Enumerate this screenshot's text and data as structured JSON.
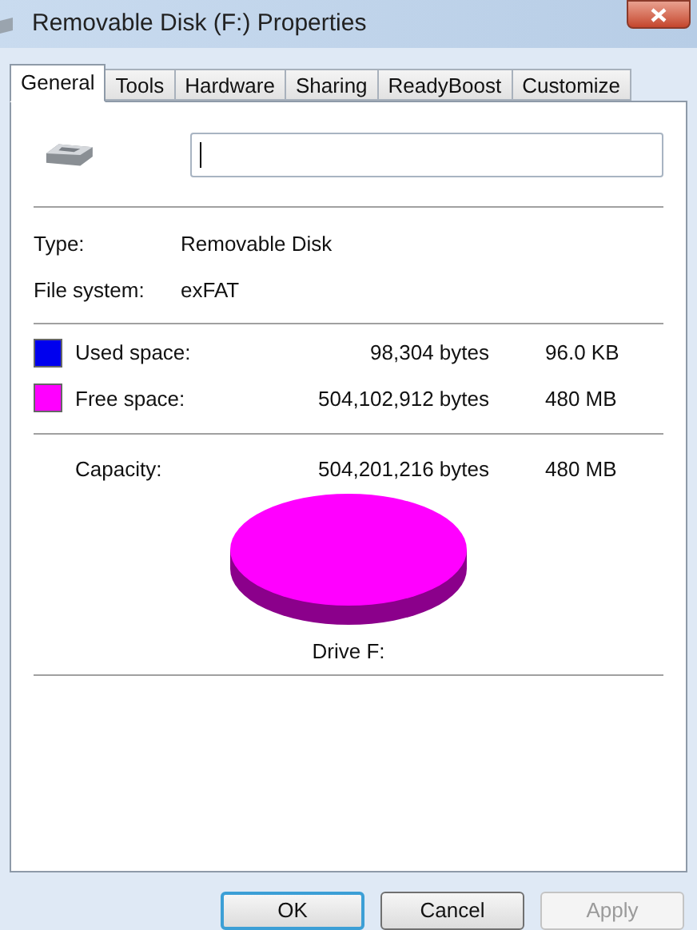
{
  "window": {
    "title": "Removable Disk (F:) Properties"
  },
  "tabs": [
    {
      "label": "General",
      "selected": true
    },
    {
      "label": "Tools",
      "selected": false
    },
    {
      "label": "Hardware",
      "selected": false
    },
    {
      "label": "Sharing",
      "selected": false
    },
    {
      "label": "ReadyBoost",
      "selected": false
    },
    {
      "label": "Customize",
      "selected": false
    }
  ],
  "properties": [
    {
      "label": "Type:",
      "value": "Removable Disk"
    },
    {
      "label": "File system:",
      "value": "exFAT"
    }
  ],
  "space": [
    {
      "label": "Used space:",
      "color": "#0000ee",
      "bytes": "98,304 bytes",
      "size": "96.0 KB"
    },
    {
      "label": "Free space:",
      "color": "#ff00ff",
      "bytes": "504,102,912 bytes",
      "size": "480 MB"
    }
  ],
  "capacity": {
    "label": "Capacity:",
    "bytes": "504,201,216 bytes",
    "size": "480 MB"
  },
  "drive_label": "Drive F:",
  "buttons": [
    {
      "label": "OK",
      "disabled": false,
      "default": true
    },
    {
      "label": "Cancel",
      "disabled": false,
      "default": false
    },
    {
      "label": "Apply",
      "disabled": true,
      "default": false
    }
  ]
}
